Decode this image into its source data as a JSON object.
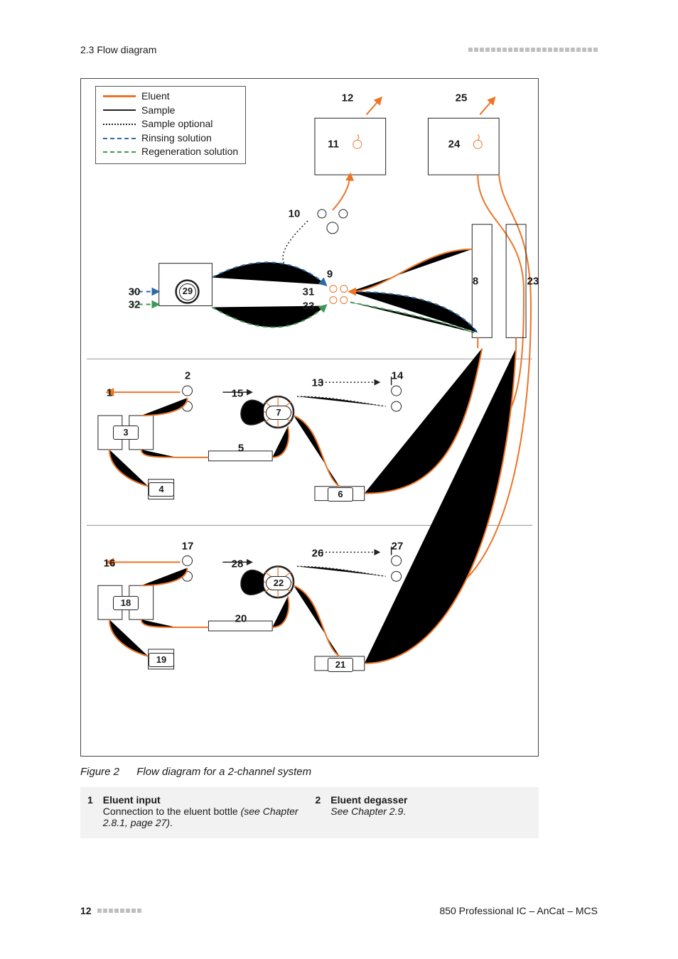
{
  "header": {
    "section": "2.3 Flow diagram"
  },
  "legend": {
    "eluent": "Eluent",
    "sample": "Sample",
    "sample_optional": "Sample optional",
    "rinsing": "Rinsing solution",
    "regeneration": "Regeneration solution"
  },
  "caption": {
    "fig": "Figure 2",
    "text": "Flow diagram for a 2-channel system"
  },
  "defs": {
    "n1": "1",
    "t1": "Eluent input",
    "d1a": "Connection to the eluent bottle ",
    "d1b": "(see Chapter 2.8.1, page 27)",
    "d1c": ".",
    "n2": "2",
    "t2": "Eluent degasser",
    "d2a": "See Chapter 2.9",
    "d2b": "."
  },
  "labels": {
    "n1": "1",
    "n2": "2",
    "n3": "3",
    "n4": "4",
    "n5": "5",
    "n6": "6",
    "n7": "7",
    "n8": "8",
    "n9": "9",
    "n10": "10",
    "n11": "11",
    "n12": "12",
    "n13": "13",
    "n14": "14",
    "n15": "15",
    "n16": "16",
    "n17": "17",
    "n18": "18",
    "n19": "19",
    "n20": "20",
    "n21": "21",
    "n22": "22",
    "n23": "23",
    "n24": "24",
    "n25": "25",
    "n26": "26",
    "n27": "27",
    "n28": "28",
    "n29": "29",
    "n30": "30",
    "n31": "31",
    "n32": "32",
    "n33": "33"
  },
  "footer": {
    "page": "12",
    "doc": "850 Professional IC – AnCat – MCS"
  }
}
